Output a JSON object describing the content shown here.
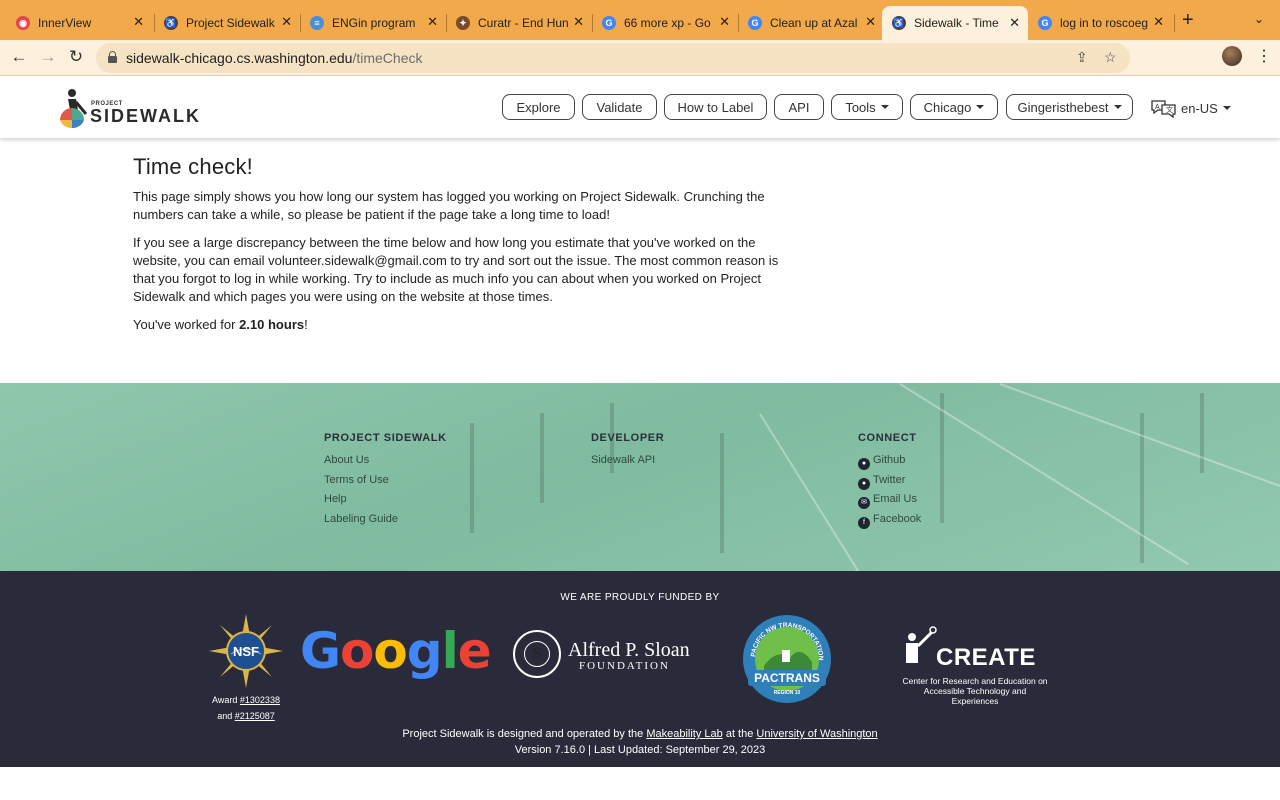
{
  "browser": {
    "tabs": [
      {
        "title": "InnerView",
        "favicon": "innerview-icon",
        "color": "#e0464a"
      },
      {
        "title": "Project Sidewalk",
        "favicon": "sidewalk-icon",
        "color": "#5a3a2a"
      },
      {
        "title": "ENGin program",
        "favicon": "engin-icon",
        "color": "#4a90d9"
      },
      {
        "title": "Curatr - End Hun",
        "favicon": "curatr-icon",
        "color": "#7a4a2a"
      },
      {
        "title": "66 more xp - Go",
        "favicon": "google-icon",
        "color": "#4285f4"
      },
      {
        "title": "Clean up at Azal",
        "favicon": "google-icon",
        "color": "#4285f4"
      },
      {
        "title": "Sidewalk - Time",
        "favicon": "sidewalk-icon",
        "color": "#5a3a2a"
      },
      {
        "title": "log in to roscoeg",
        "favicon": "google-icon",
        "color": "#4285f4"
      }
    ],
    "active_tab": 6,
    "url_host": "sidewalk-chicago.cs.washington.edu",
    "url_path": "/timeCheck"
  },
  "header": {
    "logo_small": "PROJECT",
    "logo_big": "SIDEWALK",
    "nav": {
      "explore": "Explore",
      "validate": "Validate",
      "how_to_label": "How to Label",
      "api": "API",
      "tools": "Tools",
      "city": "Chicago",
      "user": "Gingeristhebest"
    },
    "language": "en-US"
  },
  "main": {
    "title": "Time check!",
    "para1": "This page simply shows you how long our system has logged you working on Project Sidewalk. Crunching the numbers can take a while, so please be patient if the page take a long time to load!",
    "para2": "If you see a large discrepancy between the time below and how long you estimate that you've worked on the website, you can email volunteer.sidewalk@gmail.com to try and sort out the issue. The most common reason is that you forgot to log in while working. Try to include as much info you can about when you worked on Project Sidewalk and which pages you were using on the website at those times.",
    "worked_prefix": "You've worked for ",
    "worked_value": "2.10 hours",
    "worked_suffix": "!"
  },
  "footer": {
    "col1": {
      "heading": "PROJECT SIDEWALK",
      "links": [
        "About Us",
        "Terms of Use",
        "Help",
        "Labeling Guide"
      ]
    },
    "col2": {
      "heading": "DEVELOPER",
      "links": [
        "Sidewalk API"
      ]
    },
    "col3": {
      "heading": "CONNECT",
      "links": [
        "Github",
        "Twitter",
        "Email Us",
        "Facebook"
      ]
    },
    "funded_by": "WE ARE PROUDLY FUNDED BY",
    "nsf_text": "NSF",
    "award_prefix": "Award ",
    "award1": "#1302338",
    "award_and": "and ",
    "award2": "#2125087",
    "google_letters": [
      "G",
      "o",
      "o",
      "g",
      "l",
      "e"
    ],
    "google_colors": [
      "#4285f4",
      "#ea4335",
      "#fbbc05",
      "#4285f4",
      "#34a853",
      "#ea4335"
    ],
    "sloan_seal": "S",
    "sloan_name": "Alfred P. Sloan",
    "sloan_foundation": "FOUNDATION",
    "pactrans_name": "PACTRANS",
    "pactrans_ring": "PACIFIC NW TRANSPORTATION CONSORTIUM",
    "pactrans_region": "REGION 10",
    "create_word": "CREATE",
    "create_sub1": "Center for Research and Education on",
    "create_sub2": "Accessible Technology and Experiences",
    "credit_prefix": "Project Sidewalk is designed and operated by the ",
    "credit_lab": "Makeability Lab",
    "credit_mid": " at the ",
    "credit_uni": "University of Washington",
    "version": "Version 7.16.0 | Last Updated: September 29, 2023"
  },
  "colors": {
    "tabstrip": "#f1a94b",
    "footer_green": "#8fc7ad",
    "footer_dark": "#2a2b3a"
  }
}
